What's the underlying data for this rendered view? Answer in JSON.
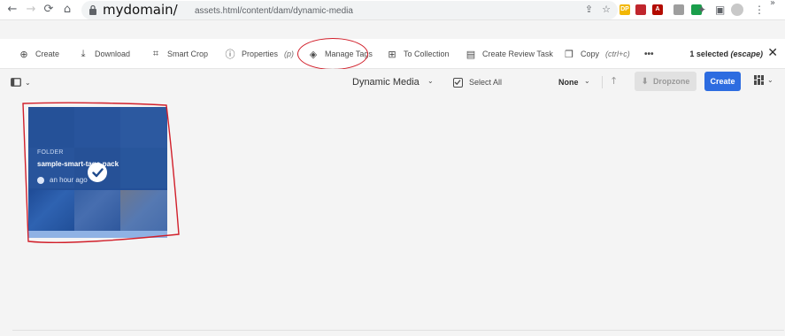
{
  "browser": {
    "url_domain": "mydomain/",
    "url_path": "assets.html/content/dam/dynamic-media",
    "extensions": [
      {
        "name": "extension-dp",
        "label": "DP",
        "color": "#f2b705"
      },
      {
        "name": "extension-red",
        "label": "",
        "color": "#c0262d"
      },
      {
        "name": "extension-acrobat",
        "label": "A",
        "color": "#b30b00"
      },
      {
        "name": "extension-gray",
        "label": "",
        "color": "#9e9e9e"
      },
      {
        "name": "extension-green",
        "label": "",
        "color": "#1a9e4b"
      }
    ],
    "more_label": "»"
  },
  "actions": [
    {
      "label": "Create",
      "icon": "plus-circle-icon"
    },
    {
      "label": "Download",
      "icon": "download-icon"
    },
    {
      "label": "Smart Crop",
      "icon": "crop-icon"
    },
    {
      "label": "Properties",
      "hint": "(p)",
      "icon": "info-icon"
    },
    {
      "label": "Manage Tags",
      "icon": "tag-icon"
    },
    {
      "label": "To Collection",
      "icon": "collection-icon"
    },
    {
      "label": "Create Review Task",
      "icon": "review-task-icon"
    },
    {
      "label": "Copy",
      "hint": "(ctrl+c)",
      "icon": "copy-icon"
    }
  ],
  "more_label": "•••",
  "selection": {
    "count_label": "1 selected",
    "escape_label": "(escape)"
  },
  "toolbar": {
    "title": "Dynamic Media",
    "select_all": "Select All",
    "sort": "None",
    "dropzone": "Dropzone",
    "create": "Create"
  },
  "card": {
    "type_label": "FOLDER",
    "name": "sample-smart-tags-pack",
    "time": "an hour ago",
    "selected": true
  },
  "colors": {
    "accent": "#2d6ce0",
    "annotation": "#d11f2a",
    "card": "#1f4a8c"
  }
}
